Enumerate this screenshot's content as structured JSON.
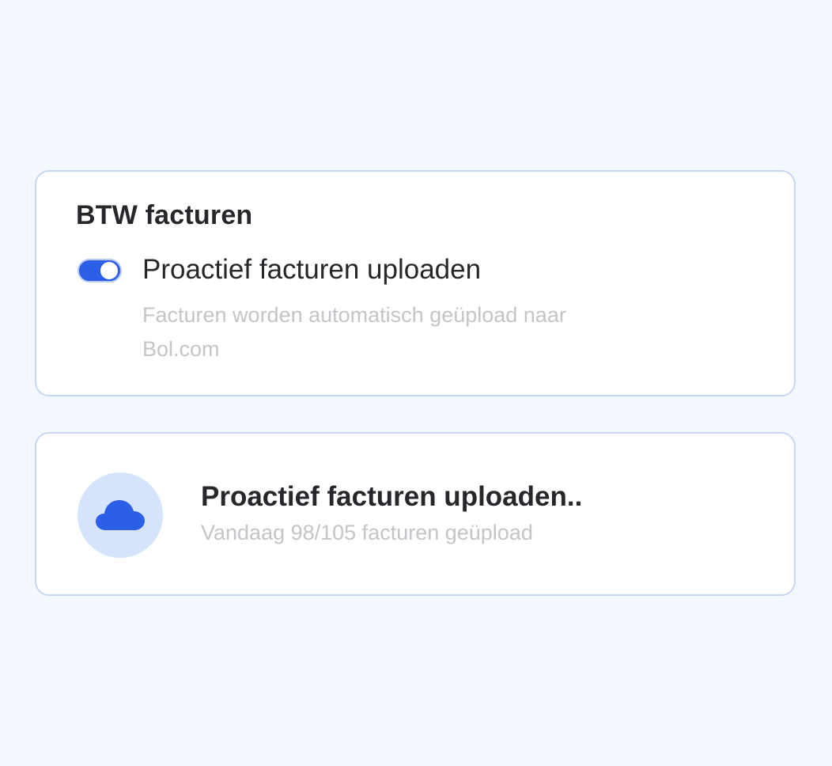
{
  "settings": {
    "title": "BTW facturen",
    "toggle": {
      "label": "Proactief facturen uploaden",
      "enabled": true,
      "description": "Facturen worden automatisch geüpload naar Bol.com"
    }
  },
  "status": {
    "icon": "cloud-icon",
    "title": "Proactief facturen uploaden..",
    "subtitle": "Vandaag 98/105 facturen geüpload"
  },
  "colors": {
    "background": "#f3f7fe",
    "accent": "#2c5ee8",
    "card_border": "#c7d7f3",
    "icon_badge": "#d6e4fb",
    "muted_text": "#c3c5c9"
  }
}
